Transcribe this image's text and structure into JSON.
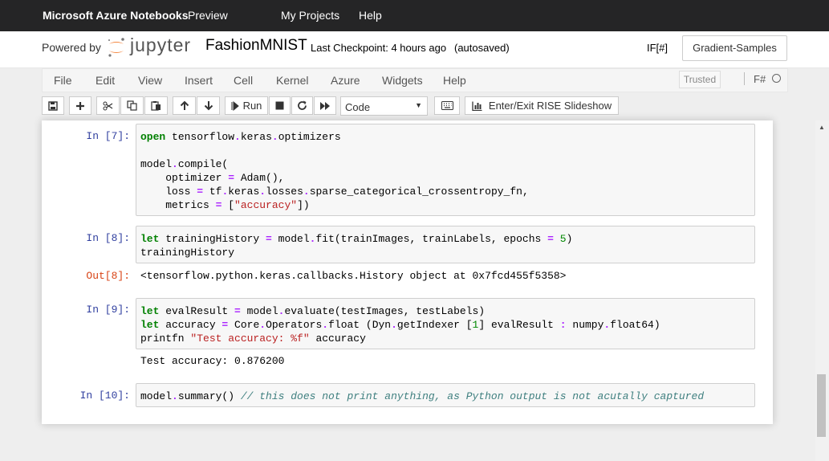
{
  "topbar": {
    "brand": "Microsoft Azure Notebooks",
    "preview": "Preview",
    "my_projects": "My Projects",
    "help": "Help"
  },
  "header": {
    "powered_by": "Powered by",
    "jupyter_logo_text": "jupyter",
    "notebook_name": "FashionMNIST",
    "checkpoint": "Last Checkpoint: 4 hours ago",
    "autosave": "(autosaved)",
    "kernel_indicator": "IF[#]",
    "project_button": "Gradient-Samples"
  },
  "menu": {
    "items": [
      "File",
      "Edit",
      "View",
      "Insert",
      "Cell",
      "Kernel",
      "Azure",
      "Widgets",
      "Help"
    ],
    "trusted": "Trusted",
    "kernel_name": "F#"
  },
  "toolbar": {
    "run_label": "Run",
    "cell_type": "Code",
    "rise_label": "Enter/Exit RISE Slideshow",
    "icons": [
      "save-icon",
      "plus-icon",
      "scissors-icon",
      "copy-icon",
      "paste-icon",
      "arrow-up-icon",
      "arrow-down-icon",
      "step-forward-icon",
      "stop-icon",
      "restart-icon",
      "fast-forward-icon",
      "keyboard-icon",
      "bar-chart-icon"
    ]
  },
  "cells": [
    {
      "prompt": "In [7]:",
      "lines": [
        [
          {
            "t": "open",
            "c": "kw"
          },
          {
            "t": " tensorflow"
          },
          {
            "t": ".",
            "c": "op"
          },
          {
            "t": "keras"
          },
          {
            "t": ".",
            "c": "op"
          },
          {
            "t": "optimizers"
          }
        ],
        [
          {
            "t": ""
          }
        ],
        [
          {
            "t": "model"
          },
          {
            "t": ".",
            "c": "op"
          },
          {
            "t": "compile("
          }
        ],
        [
          {
            "t": "    optimizer "
          },
          {
            "t": "=",
            "c": "op"
          },
          {
            "t": " Adam(),"
          }
        ],
        [
          {
            "t": "    loss "
          },
          {
            "t": "=",
            "c": "op"
          },
          {
            "t": " tf"
          },
          {
            "t": ".",
            "c": "op"
          },
          {
            "t": "keras"
          },
          {
            "t": ".",
            "c": "op"
          },
          {
            "t": "losses"
          },
          {
            "t": ".",
            "c": "op"
          },
          {
            "t": "sparse_categorical_crossentropy_fn,"
          }
        ],
        [
          {
            "t": "    metrics "
          },
          {
            "t": "=",
            "c": "op"
          },
          {
            "t": " ["
          },
          {
            "t": "\"accuracy\"",
            "c": "str"
          },
          {
            "t": "])"
          }
        ]
      ]
    },
    {
      "prompt": "In [8]:",
      "lines": [
        [
          {
            "t": "let",
            "c": "kw"
          },
          {
            "t": " trainingHistory "
          },
          {
            "t": "=",
            "c": "op"
          },
          {
            "t": " model"
          },
          {
            "t": ".",
            "c": "op"
          },
          {
            "t": "fit(trainImages, trainLabels, epochs "
          },
          {
            "t": "=",
            "c": "op"
          },
          {
            "t": " "
          },
          {
            "t": "5",
            "c": "num"
          },
          {
            "t": ")"
          }
        ],
        [
          {
            "t": "trainingHistory"
          }
        ]
      ],
      "out_prompt": "Out[8]:",
      "output": "<tensorflow.python.keras.callbacks.History object at 0x7fcd455f5358>"
    },
    {
      "prompt": "In [9]:",
      "lines": [
        [
          {
            "t": "let",
            "c": "kw"
          },
          {
            "t": " evalResult "
          },
          {
            "t": "=",
            "c": "op"
          },
          {
            "t": " model"
          },
          {
            "t": ".",
            "c": "op"
          },
          {
            "t": "evaluate(testImages, testLabels)"
          }
        ],
        [
          {
            "t": "let",
            "c": "kw"
          },
          {
            "t": " accuracy "
          },
          {
            "t": "=",
            "c": "op"
          },
          {
            "t": " Core"
          },
          {
            "t": ".",
            "c": "op"
          },
          {
            "t": "Operators"
          },
          {
            "t": ".",
            "c": "op"
          },
          {
            "t": "float (Dyn"
          },
          {
            "t": ".",
            "c": "op"
          },
          {
            "t": "getIndexer ["
          },
          {
            "t": "1",
            "c": "num"
          },
          {
            "t": "] evalResult "
          },
          {
            "t": ":",
            "c": "op"
          },
          {
            "t": " numpy"
          },
          {
            "t": ".",
            "c": "op"
          },
          {
            "t": "float64)"
          }
        ],
        [
          {
            "t": "printfn "
          },
          {
            "t": "\"Test accuracy: %f\"",
            "c": "str"
          },
          {
            "t": " accuracy"
          }
        ]
      ],
      "output": "Test accuracy: 0.876200"
    },
    {
      "prompt": "In [10]:",
      "lines": [
        [
          {
            "t": "model"
          },
          {
            "t": ".",
            "c": "op"
          },
          {
            "t": "summary() "
          },
          {
            "t": "// this does not print anything, as Python output is not acutally captured",
            "c": "cmt"
          }
        ]
      ]
    }
  ],
  "colors": {
    "topbar_bg": "#252526",
    "in_prompt": "#303f9f",
    "out_prompt": "#d84315",
    "jupyter_orange": "#f37726"
  }
}
